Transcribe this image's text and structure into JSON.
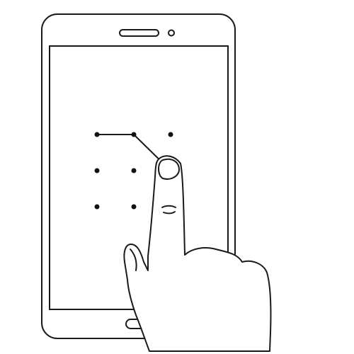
{
  "illustration": {
    "subject": "phone-pattern-unlock",
    "colors": {
      "stroke": "#1a1a1a",
      "background": "#ffffff",
      "hand_fill": "#ffffff",
      "dot": "#111111"
    },
    "unlock_pattern": {
      "grid_rows": 3,
      "grid_cols": 3,
      "visible_dots": [
        {
          "row": 1,
          "col": 1
        },
        {
          "row": 1,
          "col": 2
        },
        {
          "row": 1,
          "col": 3
        },
        {
          "row": 2,
          "col": 1
        },
        {
          "row": 2,
          "col": 2
        },
        {
          "row": 3,
          "col": 1
        },
        {
          "row": 3,
          "col": 2
        }
      ],
      "drawn_path": [
        {
          "row": 1,
          "col": 1
        },
        {
          "row": 1,
          "col": 2
        },
        {
          "row": 2,
          "col": 3
        }
      ]
    }
  }
}
